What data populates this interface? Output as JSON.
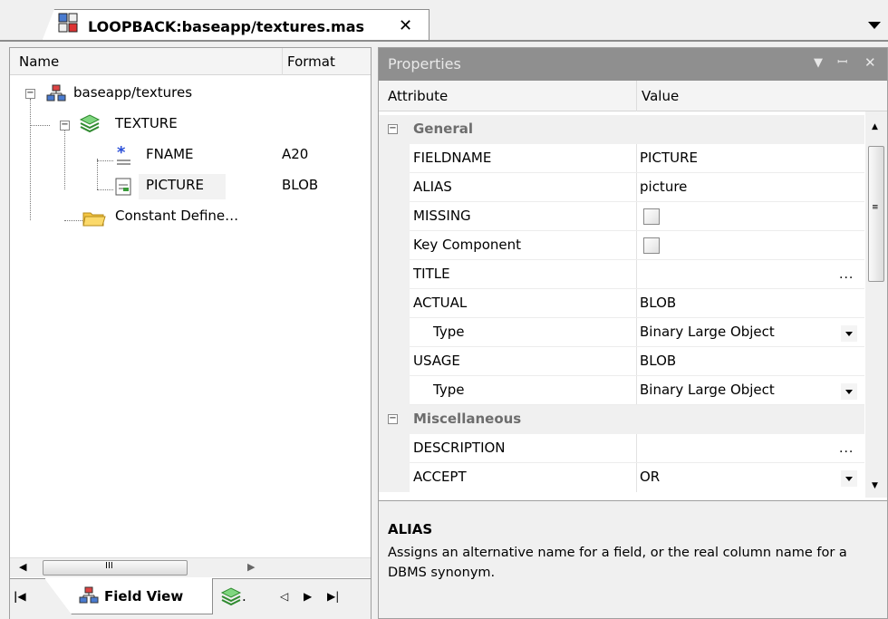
{
  "document_tab": {
    "title": "LOOPBACK:baseapp/textures.mas",
    "close": "✕",
    "icon": "app-grid-icon"
  },
  "tree": {
    "headers": {
      "name": "Name",
      "format": "Format"
    },
    "root": {
      "label": "baseapp/textures",
      "icon": "network-icon"
    },
    "segment": {
      "label": "TEXTURE",
      "icon": "stack-icon"
    },
    "fields": [
      {
        "label": "FNAME",
        "format": "A20",
        "icon": "key-field-icon"
      },
      {
        "label": "PICTURE",
        "format": "BLOB",
        "icon": "field-icon"
      }
    ],
    "constants": {
      "label": "Constant Define…",
      "icon": "folder-icon"
    },
    "scroll_grip": "III"
  },
  "bottom_tabs": {
    "field_view": "Field View",
    "second_tab_suffix": "."
  },
  "properties": {
    "title": "Properties",
    "title_buttons": [
      "▼",
      "ꟷ",
      "✕"
    ],
    "headers": {
      "attribute": "Attribute",
      "value": "Value"
    },
    "categories": {
      "general": "General",
      "misc": "Miscellaneous"
    },
    "rows": [
      {
        "attr": "FIELDNAME",
        "value": "PICTURE"
      },
      {
        "attr": "ALIAS",
        "value": "picture"
      },
      {
        "attr": "MISSING",
        "value": ""
      },
      {
        "attr": "Key Component",
        "value": ""
      },
      {
        "attr": "TITLE",
        "value": "..."
      },
      {
        "attr": "ACTUAL",
        "value": "BLOB"
      },
      {
        "attr": "Type",
        "value": "Binary Large Object"
      },
      {
        "attr": "USAGE",
        "value": "BLOB"
      },
      {
        "attr": "Type",
        "value": "Binary Large Object"
      },
      {
        "attr": "DESCRIPTION",
        "value": "..."
      },
      {
        "attr": "ACCEPT",
        "value": "OR"
      }
    ],
    "description": {
      "heading": "ALIAS",
      "text": "Assigns an alternative name for a field, or the real column name for a DBMS synonym."
    }
  }
}
